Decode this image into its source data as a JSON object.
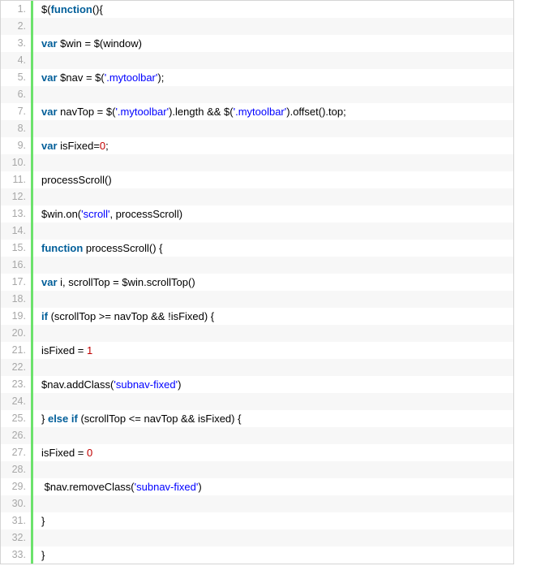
{
  "code": {
    "line_count": 33,
    "lines": [
      {
        "n": 1,
        "segs": [
          {
            "t": "$(",
            "c": "plain"
          },
          {
            "t": "function",
            "c": "keyword"
          },
          {
            "t": "(){",
            "c": "plain"
          }
        ]
      },
      {
        "n": 2,
        "segs": []
      },
      {
        "n": 3,
        "segs": [
          {
            "t": "var",
            "c": "keyword"
          },
          {
            "t": " $win = $(window)",
            "c": "plain"
          }
        ]
      },
      {
        "n": 4,
        "segs": []
      },
      {
        "n": 5,
        "segs": [
          {
            "t": "var",
            "c": "keyword"
          },
          {
            "t": " $nav = $(",
            "c": "plain"
          },
          {
            "t": "'.mytoolbar'",
            "c": "string"
          },
          {
            "t": ");",
            "c": "plain"
          }
        ]
      },
      {
        "n": 6,
        "segs": []
      },
      {
        "n": 7,
        "segs": [
          {
            "t": "var",
            "c": "keyword"
          },
          {
            "t": " navTop = $(",
            "c": "plain"
          },
          {
            "t": "'.mytoolbar'",
            "c": "string"
          },
          {
            "t": ").length && $(",
            "c": "plain"
          },
          {
            "t": "'.mytoolbar'",
            "c": "string"
          },
          {
            "t": ").offset().top;",
            "c": "plain"
          }
        ]
      },
      {
        "n": 8,
        "segs": []
      },
      {
        "n": 9,
        "segs": [
          {
            "t": "var",
            "c": "keyword"
          },
          {
            "t": " isFixed=",
            "c": "plain"
          },
          {
            "t": "0",
            "c": "number"
          },
          {
            "t": ";",
            "c": "plain"
          }
        ]
      },
      {
        "n": 10,
        "segs": []
      },
      {
        "n": 11,
        "segs": [
          {
            "t": "processScroll()",
            "c": "plain"
          }
        ]
      },
      {
        "n": 12,
        "segs": []
      },
      {
        "n": 13,
        "segs": [
          {
            "t": "$win.on(",
            "c": "plain"
          },
          {
            "t": "'scroll'",
            "c": "string"
          },
          {
            "t": ", processScroll)",
            "c": "plain"
          }
        ]
      },
      {
        "n": 14,
        "segs": []
      },
      {
        "n": 15,
        "segs": [
          {
            "t": "function",
            "c": "keyword"
          },
          {
            "t": " processScroll() {",
            "c": "plain"
          }
        ]
      },
      {
        "n": 16,
        "segs": []
      },
      {
        "n": 17,
        "segs": [
          {
            "t": "var",
            "c": "keyword"
          },
          {
            "t": " i, scrollTop = $win.scrollTop()",
            "c": "plain"
          }
        ]
      },
      {
        "n": 18,
        "segs": []
      },
      {
        "n": 19,
        "segs": [
          {
            "t": "if",
            "c": "keyword"
          },
          {
            "t": " (scrollTop >= navTop && !isFixed) {",
            "c": "plain"
          }
        ]
      },
      {
        "n": 20,
        "segs": []
      },
      {
        "n": 21,
        "segs": [
          {
            "t": "isFixed = ",
            "c": "plain"
          },
          {
            "t": "1",
            "c": "number"
          }
        ]
      },
      {
        "n": 22,
        "segs": []
      },
      {
        "n": 23,
        "segs": [
          {
            "t": "$nav.addClass(",
            "c": "plain"
          },
          {
            "t": "'subnav-fixed'",
            "c": "string"
          },
          {
            "t": ")",
            "c": "plain"
          }
        ]
      },
      {
        "n": 24,
        "segs": []
      },
      {
        "n": 25,
        "segs": [
          {
            "t": "} ",
            "c": "plain"
          },
          {
            "t": "else",
            "c": "keyword"
          },
          {
            "t": " ",
            "c": "plain"
          },
          {
            "t": "if",
            "c": "keyword"
          },
          {
            "t": " (scrollTop <= navTop && isFixed) {",
            "c": "plain"
          }
        ]
      },
      {
        "n": 26,
        "segs": []
      },
      {
        "n": 27,
        "segs": [
          {
            "t": "isFixed = ",
            "c": "plain"
          },
          {
            "t": "0",
            "c": "number"
          }
        ]
      },
      {
        "n": 28,
        "segs": []
      },
      {
        "n": 29,
        "segs": [
          {
            "t": " $nav.removeClass(",
            "c": "plain"
          },
          {
            "t": "'subnav-fixed'",
            "c": "string"
          },
          {
            "t": ")",
            "c": "plain"
          }
        ]
      },
      {
        "n": 30,
        "segs": []
      },
      {
        "n": 31,
        "segs": [
          {
            "t": "}",
            "c": "plain"
          }
        ]
      },
      {
        "n": 32,
        "segs": []
      },
      {
        "n": 33,
        "segs": [
          {
            "t": "}",
            "c": "plain"
          }
        ]
      }
    ]
  }
}
